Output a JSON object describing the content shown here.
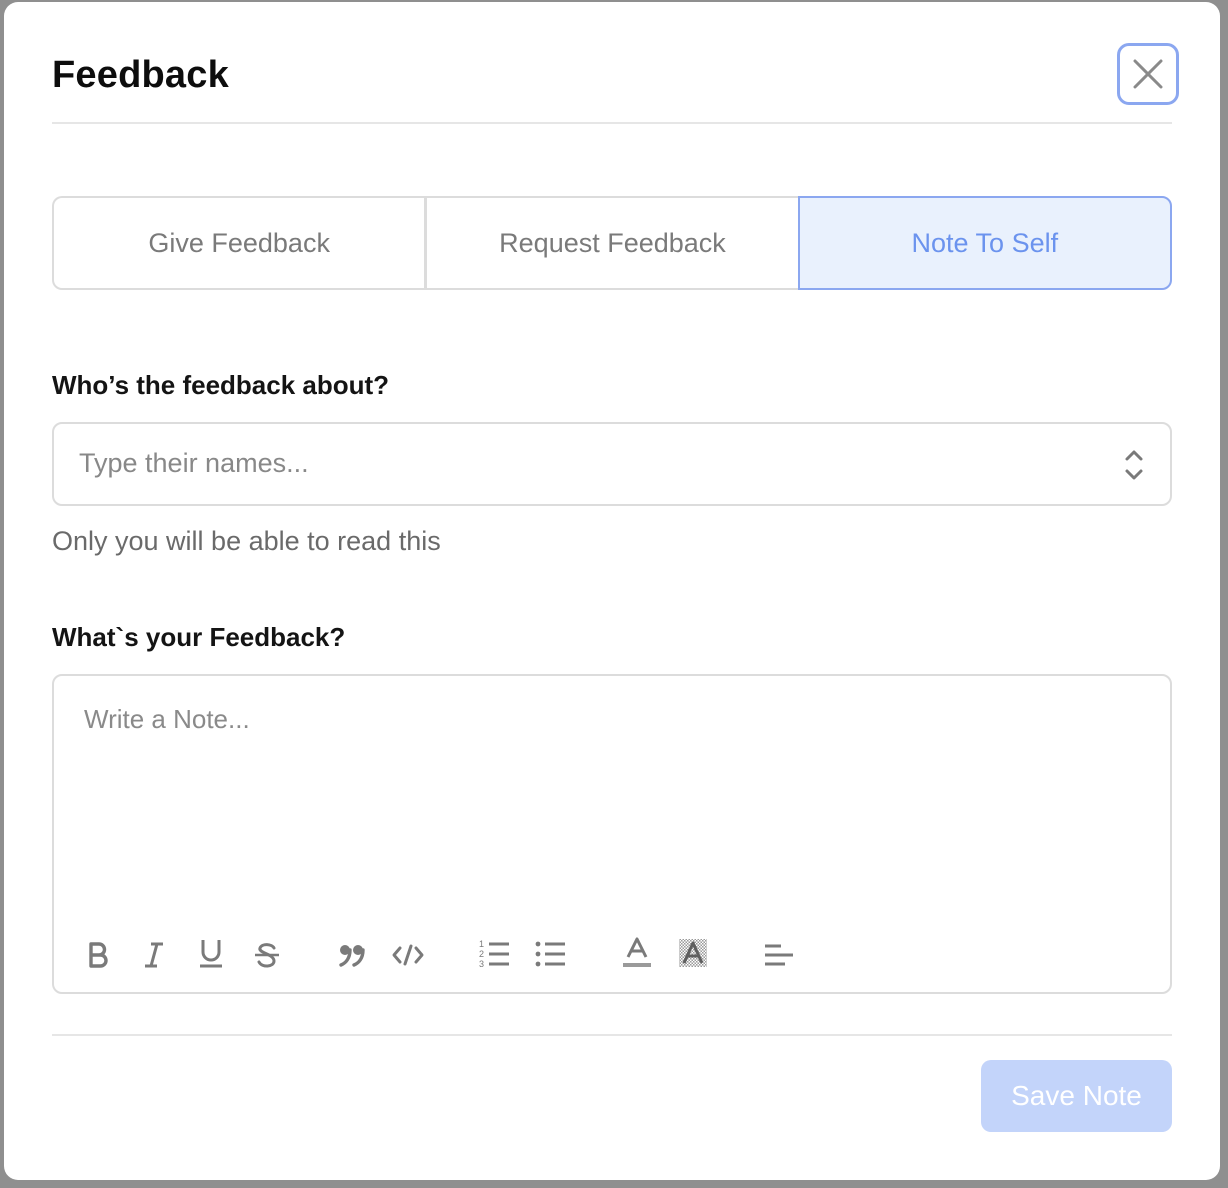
{
  "modal": {
    "title": "Feedback",
    "close_icon": "close-icon"
  },
  "tabs": [
    {
      "label": "Give Feedback",
      "active": false
    },
    {
      "label": "Request Feedback",
      "active": false
    },
    {
      "label": "Note To Self",
      "active": true
    }
  ],
  "recipient": {
    "label": "Who’s the feedback about?",
    "placeholder": "Type their names...",
    "helper": "Only you will be able to read this",
    "icon": "chevron-up-down-icon"
  },
  "feedback": {
    "label": "What`s your Feedback?",
    "placeholder": "Write a Note...",
    "toolbar": [
      "bold-icon",
      "italic-icon",
      "underline-icon",
      "strikethrough-icon",
      "quote-icon",
      "code-icon",
      "ordered-list-icon",
      "bullet-list-icon",
      "text-color-icon",
      "highlight-color-icon",
      "align-left-icon"
    ]
  },
  "footer": {
    "save_label": "Save Note"
  },
  "colors": {
    "accent": "#6b93ee",
    "accent_border": "#8ba7f0",
    "active_tab_bg": "#e9f1fd",
    "save_disabled_bg": "#c3d4fa"
  }
}
